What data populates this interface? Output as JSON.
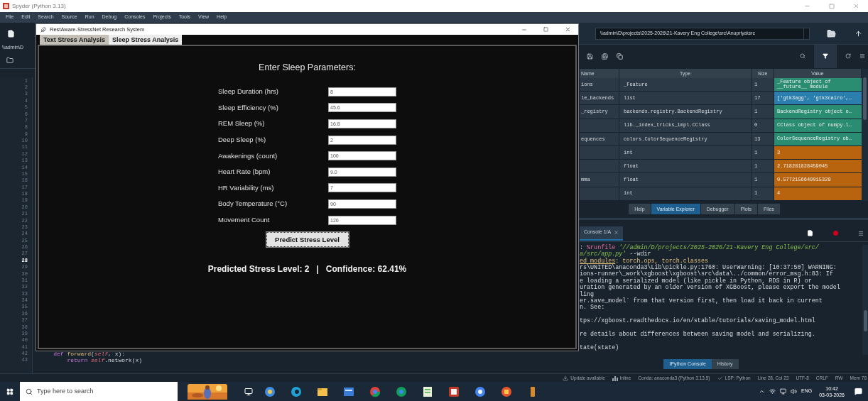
{
  "window": {
    "title": "Spyder (Python 3.13)"
  },
  "menu": [
    "File",
    "Edit",
    "Search",
    "Source",
    "Run",
    "Debug",
    "Consoles",
    "Projects",
    "Tools",
    "View",
    "Help"
  ],
  "editor": {
    "path": "\\\\admin\\D",
    "lines": [
      {
        "number": "1",
        "current": false
      },
      {
        "number": "2",
        "current": false
      },
      {
        "number": "3",
        "current": false
      },
      {
        "number": "4",
        "current": false
      },
      {
        "number": "5",
        "current": false
      },
      {
        "number": "6",
        "current": false
      },
      {
        "number": "7",
        "current": false
      },
      {
        "number": "8",
        "current": false
      },
      {
        "number": "9",
        "current": false
      },
      {
        "number": "10",
        "current": false
      },
      {
        "number": "11",
        "current": false
      },
      {
        "number": "12",
        "current": false
      },
      {
        "number": "13",
        "current": false
      },
      {
        "number": "14",
        "current": false
      },
      {
        "number": "15",
        "current": false
      },
      {
        "number": "16",
        "current": false
      },
      {
        "number": "17",
        "current": false
      },
      {
        "number": "18",
        "current": false
      },
      {
        "number": "19",
        "current": false
      },
      {
        "number": "20",
        "current": false
      },
      {
        "number": "21",
        "current": false
      },
      {
        "number": "22",
        "current": false
      },
      {
        "number": "23",
        "current": false
      },
      {
        "number": "24",
        "current": false
      },
      {
        "number": "25",
        "current": false
      },
      {
        "number": "26",
        "current": false
      },
      {
        "number": "27",
        "current": false
      },
      {
        "number": "28",
        "current": true
      },
      {
        "number": "29",
        "current": false
      },
      {
        "number": "30",
        "current": false
      },
      {
        "number": "31",
        "current": false
      },
      {
        "number": "32",
        "current": false
      },
      {
        "number": "33",
        "current": false
      },
      {
        "number": "34",
        "current": false
      },
      {
        "number": "35",
        "current": false
      },
      {
        "number": "36",
        "current": false
      },
      {
        "number": "37",
        "current": false
      },
      {
        "number": "38",
        "current": false
      },
      {
        "number": "39",
        "current": false
      },
      {
        "number": "40",
        "current": false
      },
      {
        "number": "41",
        "current": false
      },
      {
        "number": "42",
        "current": false,
        "code": [
          {
            "text": "    def ",
            "kind": "keyword"
          },
          {
            "text": "forward",
            "kind": "name"
          },
          {
            "text": "(",
            "kind": "plain"
          },
          {
            "text": "self",
            "kind": "self"
          },
          {
            "text": ", x):",
            "kind": "plain"
          }
        ]
      },
      {
        "number": "43",
        "current": false,
        "code": [
          {
            "text": "        return ",
            "kind": "keyword"
          },
          {
            "text": "self",
            "kind": "self"
          },
          {
            "text": ".network(x)",
            "kind": "plain"
          }
        ]
      }
    ]
  },
  "dialog": {
    "title": "RestAware-StressNet Research System",
    "tabs": [
      {
        "label": "Text Stress Analysis",
        "selected": false
      },
      {
        "label": "Sleep Stress Analysis",
        "selected": true
      }
    ],
    "heading": "Enter Sleep Parameters:",
    "fields": [
      {
        "label": "Sleep Duration (hrs)",
        "value": "8"
      },
      {
        "label": "Sleep Efficiency (%)",
        "value": "45.6"
      },
      {
        "label": "REM Sleep (%)",
        "value": "16.8"
      },
      {
        "label": "Deep Sleep (%)",
        "value": "2"
      },
      {
        "label": "Awakenings (count)",
        "value": "100"
      },
      {
        "label": "Heart Rate (bpm)",
        "value": "9.0"
      },
      {
        "label": "HR Variability (ms)",
        "value": "7"
      },
      {
        "label": "Body Temperature (°C)",
        "value": "90"
      },
      {
        "label": "Movement Count",
        "value": "120"
      }
    ],
    "button": "Predict Stress Level",
    "result": "Predicted Stress Level: 2   |   Confidence: 62.41%"
  },
  "explorer": {
    "path": "\\\\admin\\D\\projects\\2025-2026\\21-Kavery Eng College\\src\\Anupriya\\src",
    "columns": [
      "Name",
      "Type",
      "Size",
      "Value"
    ],
    "rows": [
      {
        "name": "ions",
        "type": "_Feature",
        "size": "1",
        "value": "_Feature object of __future__ module",
        "color": "#2a8c70"
      },
      {
        "name": "le_backends",
        "type": "list",
        "size": "17",
        "value": "['gtk3agg', 'gtk3cairo',…",
        "color": "#2b7fae"
      },
      {
        "name": "_registry",
        "type": "backends.registry.BackendRegistry",
        "size": "1",
        "value": "BackendRegistry object o…",
        "color": "#2a8c70"
      },
      {
        "type": "lib._index_tricks_impl.CClass",
        "size": "0",
        "value": "CClass object of numpy.l…",
        "color": "#2a8c70"
      },
      {
        "name": "equences",
        "type": "colors.ColorSequenceRegistry",
        "size": "13",
        "value": "ColorSequenceRegistry ob…",
        "color": "#2a8c70"
      },
      {
        "type": "int",
        "size": "1",
        "value": "3",
        "color": "#b8640e"
      },
      {
        "type": "float",
        "size": "1",
        "value": "2.718281828459045",
        "color": "#b8640e"
      },
      {
        "name": "mma",
        "type": "float",
        "size": "1",
        "value": "0.5772156649015329",
        "color": "#b8640e"
      },
      {
        "type": "int",
        "size": "1",
        "value": "4",
        "color": "#b8640e"
      }
    ],
    "tabs": [
      {
        "label": "Help",
        "selected": false
      },
      {
        "label": "Variable Explorer",
        "selected": true
      },
      {
        "label": "Debugger",
        "selected": false
      },
      {
        "label": "Plots",
        "selected": false
      },
      {
        "label": "Files",
        "selected": false
      }
    ]
  },
  "console": {
    "tab": "Console 1/A",
    "lines": [
      {
        "kind": "text",
        "parts": [
          {
            "text": ": ",
            "kind": "plain"
          },
          {
            "text": "%runfile",
            "kind": "magic"
          },
          {
            "text": " '//admin/D/projects/2025-2026/21-Kavery Eng College/src/",
            "kind": "string"
          }
        ]
      },
      {
        "kind": "text",
        "parts": [
          {
            "text": "a/src/app.py'",
            "kind": "string"
          },
          {
            "text": " --wdir",
            "kind": "plain"
          }
        ]
      },
      {
        "kind": "text",
        "parts": [
          {
            "text": "ed modules",
            "kind": "warn-link"
          },
          {
            "text": ": torch.ops, torch.classes",
            "kind": "warn"
          }
        ]
      },
      {
        "kind": "text",
        "parts": [
          {
            "text": "rs\\UNITED\\anaconda3\\Lib\\pickle.py:1760: UserWarning: [10:37:50] WARNING:",
            "kind": "plain"
          }
        ]
      },
      {
        "kind": "text",
        "parts": [
          {
            "text": "ions-runner\\_work\\xgboost\\xgboost\\src\\data\\../common/error_msg.h:83: If",
            "kind": "plain"
          }
        ]
      },
      {
        "kind": "text",
        "parts": [
          {
            "text": "e loading a serialized model (like pickle in Python, RDS in R) or",
            "kind": "plain"
          }
        ]
      },
      {
        "kind": "text",
        "parts": [
          {
            "text": "uration generated by an older version of XGBoost, please export the model",
            "kind": "plain"
          }
        ]
      },
      {
        "kind": "text",
        "parts": [
          {
            "text": "ling",
            "kind": "plain"
          }
        ]
      },
      {
        "kind": "text",
        "parts": [
          {
            "text": "er.save_model` from that version first, then load it back in current",
            "kind": "plain"
          }
        ]
      },
      {
        "kind": "text",
        "parts": [
          {
            "text": "n. See:",
            "kind": "plain"
          }
        ]
      },
      {
        "kind": "blank"
      },
      {
        "kind": "text",
        "parts": [
          {
            "text": "tps://xgboost.readthedocs.io/en/stable/tutorials/saving_model.html",
            "kind": "plain"
          }
        ]
      },
      {
        "kind": "blank"
      },
      {
        "kind": "text",
        "parts": [
          {
            "text": "re details about differences between saving model and serializing.",
            "kind": "plain"
          }
        ]
      },
      {
        "kind": "blank"
      },
      {
        "kind": "text",
        "parts": [
          {
            "text": "tate(state)",
            "kind": "plain"
          }
        ]
      }
    ],
    "tabs": [
      {
        "label": "IPython Console",
        "selected": true
      },
      {
        "label": "History",
        "selected": false
      }
    ]
  },
  "status_bar": [
    {
      "text": "Update available",
      "kind": "update"
    },
    {
      "text": "Inline",
      "kind": "chart"
    },
    {
      "text": "Conda: anaconda3 (Python 3.13.5)",
      "kind": "plain"
    },
    {
      "text": "LSP: Python",
      "kind": "check"
    },
    {
      "text": "Line 28, Col 23",
      "kind": "plain"
    },
    {
      "text": "UTF-8",
      "kind": "plain"
    },
    {
      "text": "CRLF",
      "kind": "plain"
    },
    {
      "text": "RW",
      "kind": "plain"
    },
    {
      "text": "Mem 78",
      "kind": "plain"
    }
  ],
  "taskbar": {
    "search": {
      "placeholder": "Type here to search"
    },
    "language": "ENG",
    "time": "10:42",
    "date": "03-03-2026"
  }
}
